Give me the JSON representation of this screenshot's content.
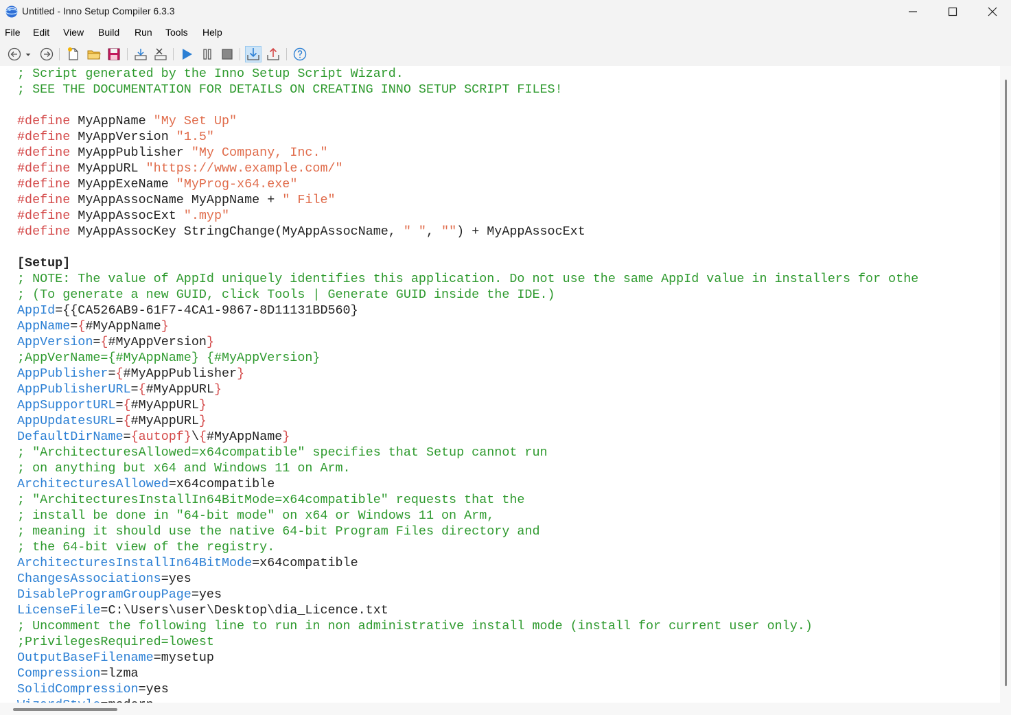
{
  "window": {
    "title": "Untitled - Inno Setup Compiler 6.3.3",
    "minimize_icon": "minimize-icon",
    "maximize_icon": "maximize-icon",
    "close_icon": "close-icon"
  },
  "menu": [
    "File",
    "Edit",
    "View",
    "Build",
    "Run",
    "Tools",
    "Help"
  ],
  "toolbar": {
    "icons": [
      "back-arrow-icon",
      "dropdown-arrow-icon",
      "forward-arrow-icon",
      "new-file-icon",
      "open-folder-icon",
      "save-icon",
      "compile-icon",
      "stop-compile-icon",
      "run-icon",
      "pause-icon",
      "stop-icon",
      "target-install-icon",
      "target-uninstall-icon",
      "help-icon"
    ]
  },
  "editor": {
    "lines": [
      [
        {
          "t": "; Script generated by the Inno Setup Script Wizard.",
          "c": "com"
        }
      ],
      [
        {
          "t": "; SEE THE DOCUMENTATION FOR DETAILS ON CREATING INNO SETUP SCRIPT FILES!",
          "c": "com"
        }
      ],
      [],
      [
        {
          "t": "#define",
          "c": "dir"
        },
        {
          "t": " MyAppName ",
          "c": "id"
        },
        {
          "t": "\"My Set Up\"",
          "c": "str"
        }
      ],
      [
        {
          "t": "#define",
          "c": "dir"
        },
        {
          "t": " MyAppVersion ",
          "c": "id"
        },
        {
          "t": "\"1.5\"",
          "c": "str"
        }
      ],
      [
        {
          "t": "#define",
          "c": "dir"
        },
        {
          "t": " MyAppPublisher ",
          "c": "id"
        },
        {
          "t": "\"My Company, Inc.\"",
          "c": "str"
        }
      ],
      [
        {
          "t": "#define",
          "c": "dir"
        },
        {
          "t": " MyAppURL ",
          "c": "id"
        },
        {
          "t": "\"https://www.example.com/\"",
          "c": "str"
        }
      ],
      [
        {
          "t": "#define",
          "c": "dir"
        },
        {
          "t": " MyAppExeName ",
          "c": "id"
        },
        {
          "t": "\"MyProg-x64.exe\"",
          "c": "str"
        }
      ],
      [
        {
          "t": "#define",
          "c": "dir"
        },
        {
          "t": " MyAppAssocName MyAppName + ",
          "c": "id"
        },
        {
          "t": "\" File\"",
          "c": "str"
        }
      ],
      [
        {
          "t": "#define",
          "c": "dir"
        },
        {
          "t": " MyAppAssocExt ",
          "c": "id"
        },
        {
          "t": "\".myp\"",
          "c": "str"
        }
      ],
      [
        {
          "t": "#define",
          "c": "dir"
        },
        {
          "t": " MyAppAssocKey StringChange(MyAppAssocName, ",
          "c": "id"
        },
        {
          "t": "\" \"",
          "c": "str"
        },
        {
          "t": ", ",
          "c": "id"
        },
        {
          "t": "\"\"",
          "c": "str"
        },
        {
          "t": ") + MyAppAssocExt",
          "c": "id"
        }
      ],
      [],
      [
        {
          "t": "[Setup]",
          "c": "sec"
        }
      ],
      [
        {
          "t": "; NOTE: The value of AppId uniquely identifies this application. Do not use the same AppId value in installers for othe",
          "c": "com"
        }
      ],
      [
        {
          "t": "; (To generate a new GUID, click Tools | Generate GUID inside the IDE.)",
          "c": "com"
        }
      ],
      [
        {
          "t": "AppId",
          "c": "key"
        },
        {
          "t": "={{CA526AB9-61F7-4CA1-9867-8D11131BD560}",
          "c": "txt"
        }
      ],
      [
        {
          "t": "AppName",
          "c": "key"
        },
        {
          "t": "=",
          "c": "txt"
        },
        {
          "t": "{",
          "c": "brace"
        },
        {
          "t": "#MyAppName",
          "c": "txt"
        },
        {
          "t": "}",
          "c": "brace"
        }
      ],
      [
        {
          "t": "AppVersion",
          "c": "key"
        },
        {
          "t": "=",
          "c": "txt"
        },
        {
          "t": "{",
          "c": "brace"
        },
        {
          "t": "#MyAppVersion",
          "c": "txt"
        },
        {
          "t": "}",
          "c": "brace"
        }
      ],
      [
        {
          "t": ";AppVerName={#MyAppName} {#MyAppVersion}",
          "c": "com"
        }
      ],
      [
        {
          "t": "AppPublisher",
          "c": "key"
        },
        {
          "t": "=",
          "c": "txt"
        },
        {
          "t": "{",
          "c": "brace"
        },
        {
          "t": "#MyAppPublisher",
          "c": "txt"
        },
        {
          "t": "}",
          "c": "brace"
        }
      ],
      [
        {
          "t": "AppPublisherURL",
          "c": "key"
        },
        {
          "t": "=",
          "c": "txt"
        },
        {
          "t": "{",
          "c": "brace"
        },
        {
          "t": "#MyAppURL",
          "c": "txt"
        },
        {
          "t": "}",
          "c": "brace"
        }
      ],
      [
        {
          "t": "AppSupportURL",
          "c": "key"
        },
        {
          "t": "=",
          "c": "txt"
        },
        {
          "t": "{",
          "c": "brace"
        },
        {
          "t": "#MyAppURL",
          "c": "txt"
        },
        {
          "t": "}",
          "c": "brace"
        }
      ],
      [
        {
          "t": "AppUpdatesURL",
          "c": "key"
        },
        {
          "t": "=",
          "c": "txt"
        },
        {
          "t": "{",
          "c": "brace"
        },
        {
          "t": "#MyAppURL",
          "c": "txt"
        },
        {
          "t": "}",
          "c": "brace"
        }
      ],
      [
        {
          "t": "DefaultDirName",
          "c": "key"
        },
        {
          "t": "=",
          "c": "txt"
        },
        {
          "t": "{autopf}",
          "c": "brace"
        },
        {
          "t": "\\",
          "c": "txt"
        },
        {
          "t": "{",
          "c": "brace"
        },
        {
          "t": "#MyAppName",
          "c": "txt"
        },
        {
          "t": "}",
          "c": "brace"
        }
      ],
      [
        {
          "t": "; \"ArchitecturesAllowed=x64compatible\" specifies that Setup cannot run",
          "c": "com"
        }
      ],
      [
        {
          "t": "; on anything but x64 and Windows 11 on Arm.",
          "c": "com"
        }
      ],
      [
        {
          "t": "ArchitecturesAllowed",
          "c": "key"
        },
        {
          "t": "=x64compatible",
          "c": "txt"
        }
      ],
      [
        {
          "t": "; \"ArchitecturesInstallIn64BitMode=x64compatible\" requests that the",
          "c": "com"
        }
      ],
      [
        {
          "t": "; install be done in \"64-bit mode\" on x64 or Windows 11 on Arm,",
          "c": "com"
        }
      ],
      [
        {
          "t": "; meaning it should use the native 64-bit Program Files directory and",
          "c": "com"
        }
      ],
      [
        {
          "t": "; the 64-bit view of the registry.",
          "c": "com"
        }
      ],
      [
        {
          "t": "ArchitecturesInstallIn64BitMode",
          "c": "key"
        },
        {
          "t": "=x64compatible",
          "c": "txt"
        }
      ],
      [
        {
          "t": "ChangesAssociations",
          "c": "key"
        },
        {
          "t": "=yes",
          "c": "txt"
        }
      ],
      [
        {
          "t": "DisableProgramGroupPage",
          "c": "key"
        },
        {
          "t": "=yes",
          "c": "txt"
        }
      ],
      [
        {
          "t": "LicenseFile",
          "c": "key"
        },
        {
          "t": "=C:\\Users\\user\\Desktop\\dia_Licence.txt",
          "c": "txt"
        }
      ],
      [
        {
          "t": "; Uncomment the following line to run in non administrative install mode (install for current user only.)",
          "c": "com"
        }
      ],
      [
        {
          "t": ";PrivilegesRequired=lowest",
          "c": "com"
        }
      ],
      [
        {
          "t": "OutputBaseFilename",
          "c": "key"
        },
        {
          "t": "=mysetup",
          "c": "txt"
        }
      ],
      [
        {
          "t": "Compression",
          "c": "key"
        },
        {
          "t": "=lzma",
          "c": "txt"
        }
      ],
      [
        {
          "t": "SolidCompression",
          "c": "key"
        },
        {
          "t": "=yes",
          "c": "txt"
        }
      ],
      [
        {
          "t": "WizardStyle",
          "c": "key"
        },
        {
          "t": "=modern",
          "c": "txt"
        }
      ]
    ]
  },
  "colors": {
    "comment": "#2e9a2e",
    "directive": "#d44a4a",
    "string": "#e06b4a",
    "key": "#2b7fd4",
    "accent": "#3a7bd5"
  }
}
